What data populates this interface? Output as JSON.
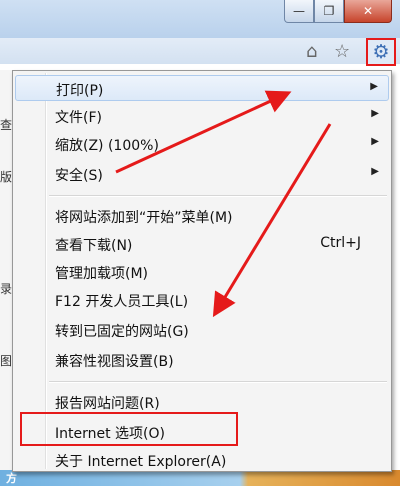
{
  "window": {
    "minimize_glyph": "—",
    "maximize_glyph": "❐",
    "close_glyph": "✕"
  },
  "commandbar": {
    "home_icon": "home-icon",
    "favorites_icon": "star-icon",
    "tools_icon": "gear-icon"
  },
  "background": {
    "fragments": [
      "查",
      "版",
      "录",
      "图",
      "方"
    ]
  },
  "menu": {
    "items": [
      {
        "label": "打印(P)",
        "submenu": true
      },
      {
        "label": "文件(F)",
        "submenu": true
      },
      {
        "label": "缩放(Z) (100%)",
        "submenu": true
      },
      {
        "label": "安全(S)",
        "submenu": true
      },
      {
        "label": "将网站添加到“开始”菜单(M)"
      },
      {
        "label": "查看下载(N)",
        "shortcut": "Ctrl+J"
      },
      {
        "label": "管理加载项(M)"
      },
      {
        "label": "F12 开发人员工具(L)"
      },
      {
        "label": "转到已固定的网站(G)"
      },
      {
        "label": "兼容性视图设置(B)"
      },
      {
        "label": "报告网站问题(R)"
      },
      {
        "label": "Internet 选项(O)"
      },
      {
        "label": "关于 Internet Explorer(A)"
      }
    ]
  },
  "annotation": {
    "color": "#e51a1a"
  }
}
